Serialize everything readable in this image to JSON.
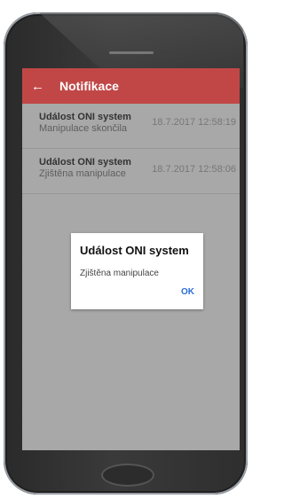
{
  "appbar": {
    "title": "Notifikace",
    "back_icon": "←"
  },
  "notifications": [
    {
      "title": "Událost ONI system",
      "message": "Manipulace skončila",
      "timestamp": "18.7.2017 12:58:19"
    },
    {
      "title": "Událost ONI system",
      "message": "Zjištěna manipulace",
      "timestamp": "18.7.2017 12:58:06"
    }
  ],
  "dialog": {
    "title": "Událost ONI system",
    "message": "Zjištěna manipulace",
    "ok_label": "OK"
  },
  "colors": {
    "appbar": "#c14747",
    "accent": "#2a6fd6",
    "overlay": "#a8a8a8"
  }
}
